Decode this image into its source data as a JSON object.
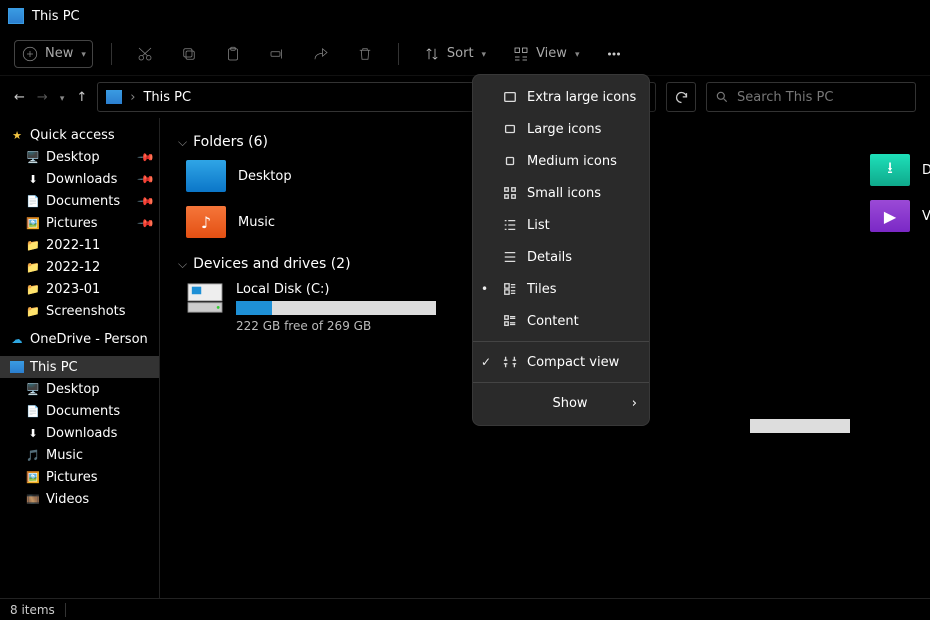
{
  "titlebar": {
    "title": "This PC"
  },
  "toolbar": {
    "new_label": "New",
    "sort_label": "Sort",
    "view_label": "View"
  },
  "breadcrumb": {
    "current": "This PC",
    "sep": "›"
  },
  "search": {
    "placeholder": "Search This PC"
  },
  "sidebar": {
    "quick_access": "Quick access",
    "items_qa": [
      {
        "label": "Desktop",
        "icon": "🖥️",
        "pinned": true
      },
      {
        "label": "Downloads",
        "icon": "⬇",
        "pinned": true
      },
      {
        "label": "Documents",
        "icon": "📄",
        "pinned": true
      },
      {
        "label": "Pictures",
        "icon": "🖼️",
        "pinned": true
      },
      {
        "label": "2022-11",
        "icon": "📁",
        "pinned": false
      },
      {
        "label": "2022-12",
        "icon": "📁",
        "pinned": false
      },
      {
        "label": "2023-01",
        "icon": "📁",
        "pinned": false
      },
      {
        "label": "Screenshots",
        "icon": "📁",
        "pinned": false
      }
    ],
    "onedrive": "OneDrive - Person",
    "thispc": "This PC",
    "items_pc": [
      {
        "label": "Desktop",
        "icon": "🖥️"
      },
      {
        "label": "Documents",
        "icon": "📄"
      },
      {
        "label": "Downloads",
        "icon": "⬇"
      },
      {
        "label": "Music",
        "icon": "🎵"
      },
      {
        "label": "Pictures",
        "icon": "🖼️"
      },
      {
        "label": "Videos",
        "icon": "🎞️"
      }
    ]
  },
  "sections": {
    "folders_hdr": "Folders (6)",
    "drives_hdr": "Devices and drives (2)",
    "folders_left": [
      {
        "label": "Desktop",
        "class": "f-desktop",
        "glyph": ""
      },
      {
        "label": "Music",
        "class": "f-music",
        "glyph": "♪"
      }
    ],
    "folders_right": [
      {
        "label": "Downloads",
        "class": "f-downloads",
        "glyph": "⭳"
      },
      {
        "label": "Videos",
        "class": "f-videos",
        "glyph": "▶"
      }
    ],
    "drive": {
      "name": "Local Disk (C:)",
      "sub": "222 GB free of 269 GB",
      "fill_pct": 18
    }
  },
  "viewmenu": {
    "items": [
      {
        "label": "Extra large icons",
        "iconkey": "xl"
      },
      {
        "label": "Large icons",
        "iconkey": "lg"
      },
      {
        "label": "Medium icons",
        "iconkey": "md"
      },
      {
        "label": "Small icons",
        "iconkey": "sm"
      },
      {
        "label": "List",
        "iconkey": "list"
      },
      {
        "label": "Details",
        "iconkey": "details"
      },
      {
        "label": "Tiles",
        "iconkey": "tiles",
        "selected": true
      },
      {
        "label": "Content",
        "iconkey": "content"
      }
    ],
    "compact": {
      "label": "Compact view",
      "checked": true
    },
    "show": "Show"
  },
  "statusbar": {
    "text": "8 items"
  }
}
